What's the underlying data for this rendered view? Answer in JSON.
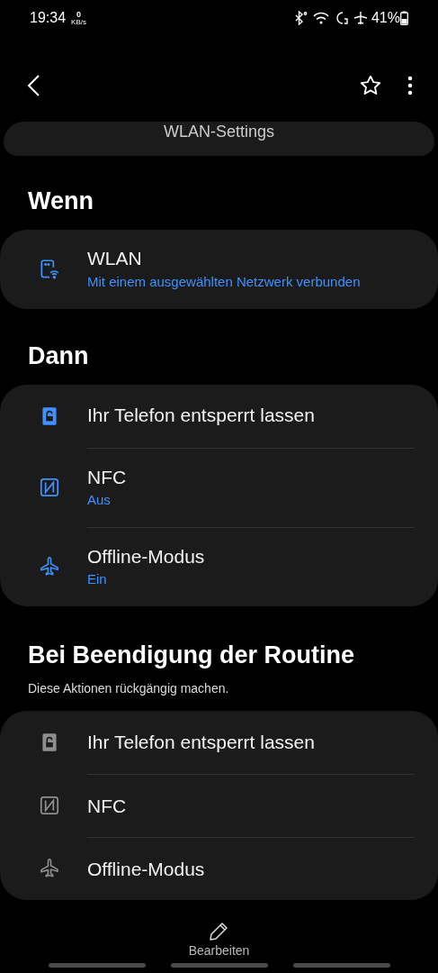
{
  "status_bar": {
    "time": "19:34",
    "data_rate": "0",
    "data_unit": "KB/s",
    "battery": "41%"
  },
  "header": {
    "title": "WLAN-Settings",
    "favorite": false
  },
  "sections": [
    {
      "title": "Wenn",
      "items": [
        {
          "kind": "wifi-phone",
          "active": true,
          "label": "WLAN",
          "value": "Mit einem ausgewählten Netzwerk verbunden"
        }
      ]
    },
    {
      "title": "Dann",
      "items": [
        {
          "kind": "lock",
          "active": true,
          "label": "Ihr Telefon entsperrt lassen"
        },
        {
          "kind": "nfc",
          "active": true,
          "label": "NFC",
          "value": "Aus"
        },
        {
          "kind": "airplane",
          "active": true,
          "label": "Offline-Modus",
          "value": "Ein"
        }
      ]
    },
    {
      "title": "Bei Beendigung der Routine",
      "subtitle": "Diese Aktionen rückgängig machen.",
      "items": [
        {
          "kind": "lock",
          "active": false,
          "label": "Ihr Telefon entsperrt lassen"
        },
        {
          "kind": "nfc",
          "active": false,
          "label": "NFC"
        },
        {
          "kind": "airplane",
          "active": false,
          "label": "Offline-Modus"
        }
      ]
    }
  ],
  "bottom_action": {
    "label": "Bearbeiten"
  }
}
